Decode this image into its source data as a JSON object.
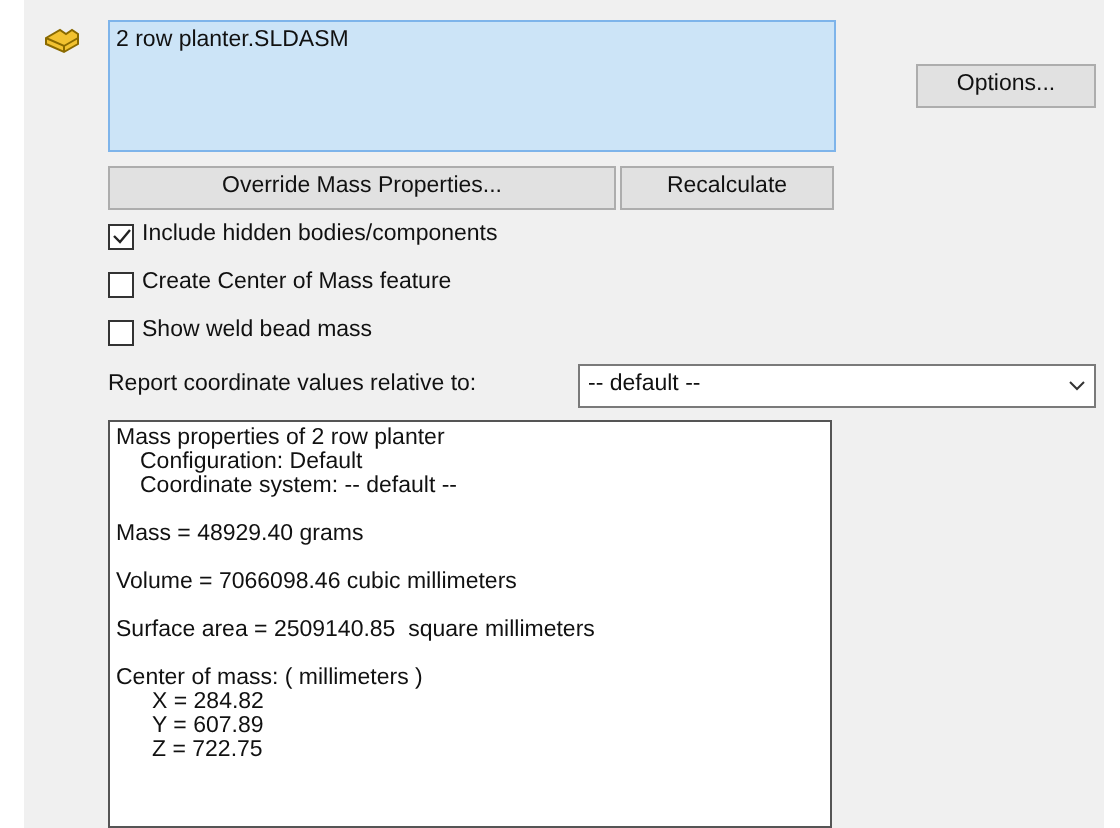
{
  "selection_list": {
    "items": [
      "2 row planter.SLDASM"
    ]
  },
  "buttons": {
    "options": "Options...",
    "override": "Override Mass Properties...",
    "recalculate": "Recalculate"
  },
  "checkboxes": [
    {
      "label": "Include hidden bodies/components",
      "checked": true
    },
    {
      "label": "Create Center of Mass feature",
      "checked": false
    },
    {
      "label": "Show weld bead mass",
      "checked": false
    }
  ],
  "coordinate_report": {
    "label": "Report coordinate values relative to:",
    "value": "-- default --"
  },
  "results": [
    {
      "text": "Mass properties of 2 row planter",
      "children": [
        {
          "text": "Configuration: Default"
        },
        {
          "text": "Coordinate system: -- default --"
        }
      ]
    },
    {
      "text": "Mass = 48929.40 grams"
    },
    {
      "text": "Volume = 7066098.46 cubic millimeters"
    },
    {
      "text": "Surface area = 2509140.85  square millimeters"
    },
    {
      "text": "Center of mass: ( millimeters )",
      "children": [
        {
          "text": "X = 284.82"
        },
        {
          "text": "Y = 607.89"
        },
        {
          "text": "Z = 722.75"
        }
      ]
    }
  ]
}
